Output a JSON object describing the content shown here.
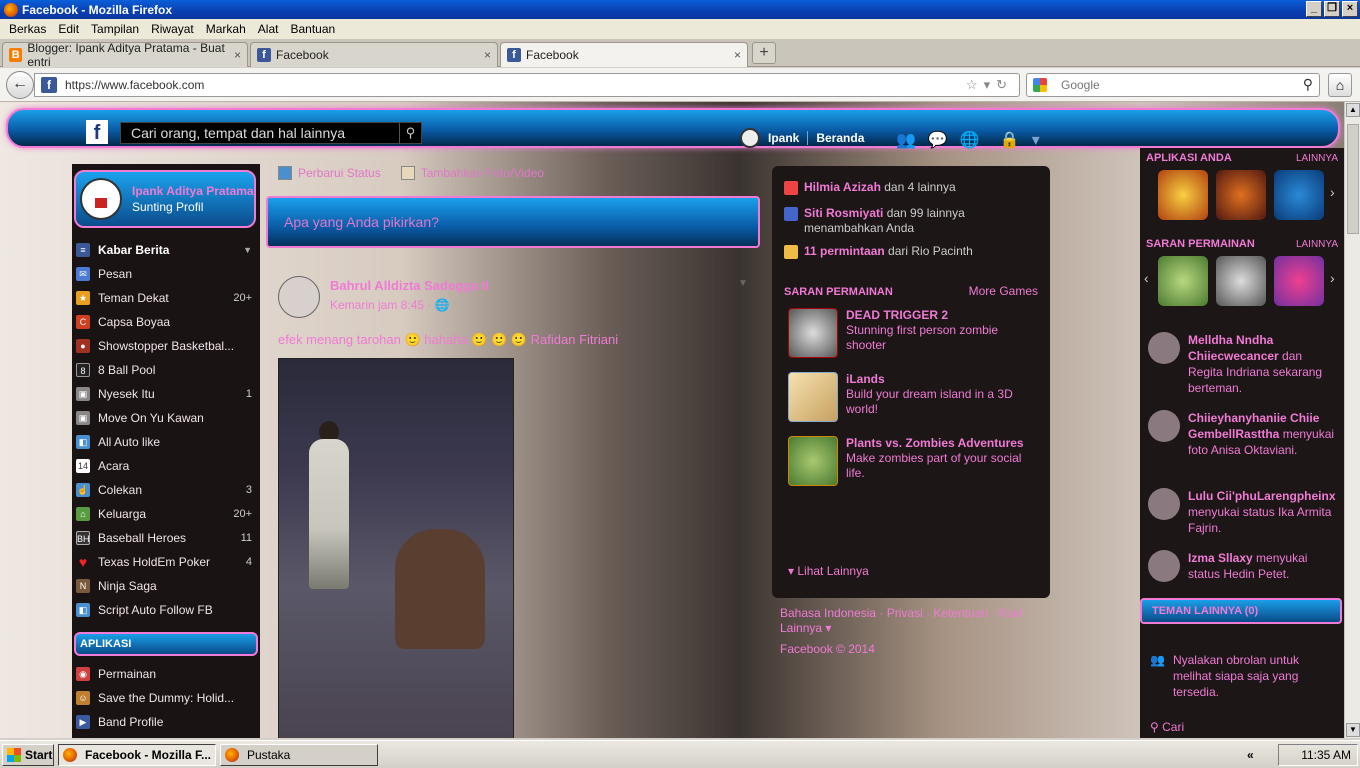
{
  "window": {
    "title": "Facebook - Mozilla Firefox"
  },
  "menu": [
    "Berkas",
    "Edit",
    "Tampilan",
    "Riwayat",
    "Markah",
    "Alat",
    "Bantuan"
  ],
  "tabs": [
    {
      "label": "Blogger: Ipank Aditya Pratama - Buat entri"
    },
    {
      "label": "Facebook"
    },
    {
      "label": "Facebook"
    }
  ],
  "nav": {
    "url": "https://www.facebook.com",
    "search_placeholder": "Google"
  },
  "fb": {
    "search_placeholder": "Cari orang, tempat dan hal lainnya",
    "user_short": "Ipank",
    "home_label": "Beranda",
    "profile_name": "Ipank Aditya Pratama",
    "profile_sub": "Sunting Profil",
    "left_items": [
      {
        "label": "Kabar Berita",
        "count": "",
        "head": true
      },
      {
        "label": "Pesan",
        "count": ""
      },
      {
        "label": "Teman Dekat",
        "count": "20+"
      },
      {
        "label": "Capsa Boyaa",
        "count": ""
      },
      {
        "label": "Showstopper Basketbal...",
        "count": ""
      },
      {
        "label": "8 Ball Pool",
        "count": ""
      },
      {
        "label": "Nyesek Itu",
        "count": "1"
      },
      {
        "label": "Move On Yu Kawan",
        "count": ""
      },
      {
        "label": "All Auto like",
        "count": ""
      },
      {
        "label": "Acara",
        "count": ""
      },
      {
        "label": "Colekan",
        "count": "3"
      },
      {
        "label": "Keluarga",
        "count": "20+"
      },
      {
        "label": "Baseball Heroes",
        "count": "11"
      },
      {
        "label": "Texas HoldEm Poker",
        "count": "4"
      },
      {
        "label": "Ninja Saga",
        "count": ""
      },
      {
        "label": "Script Auto Follow FB",
        "count": ""
      }
    ],
    "apps_header": "APLIKASI",
    "app_items": [
      {
        "label": "Permainan"
      },
      {
        "label": "Save the Dummy: Holid..."
      },
      {
        "label": "Band Profile"
      }
    ],
    "composer": {
      "tab_status": "Perbarui Status",
      "tab_photo": "Tambahkan Foto/Video",
      "placeholder": "Apa yang Anda pikirkan?"
    },
    "post": {
      "author": "Bahrul Alldizta Sadegga II",
      "time": "Kemarin jam 8:45 · 🌐",
      "text": "efek menang tarohan 🙂 hahaha 🙂 🙂 🙂 Rafidan Fitriani"
    },
    "notifications": [
      {
        "bold": "Hilmia Azizah",
        "rest": " dan 4 lainnya",
        "color": "#e44"
      },
      {
        "bold": "Siti Rosmiyati",
        "rest": " dan 99 lainnya menambahkan Anda",
        "color": "#46c"
      },
      {
        "bold": "11 permintaan",
        "rest": " dari Rio Pacinth",
        "color": "#eb4"
      }
    ],
    "suggest_header": "SARAN PERMAINAN",
    "suggest_more": "More Games",
    "games": [
      {
        "title": "DEAD TRIGGER 2",
        "desc": "Stunning first person zombie shooter"
      },
      {
        "title": "iLands",
        "desc": "Build your dream island in a 3D world!"
      },
      {
        "title": "Plants vs. Zombies Adventures",
        "desc": "Make zombies part of your social life."
      }
    ],
    "see_more": "Lihat Lainnya",
    "footer": "Bahasa Indonesia · Privasi · Ketentuan · Kuki · Lainnya ▾",
    "copyright": "Facebook © 2014",
    "right": {
      "apps_h": "APLIKASI ANDA",
      "games_h": "SARAN PERMAINAN",
      "more": "LAINNYA",
      "ticker": [
        {
          "bold": "Melldha Nndha Chiiecwecancer",
          "rest": " dan Regita Indriana sekarang berteman."
        },
        {
          "bold": "Chiieyhanyhaniie Chiie GembellRasttha",
          "rest": " menyukai foto Anisa Oktaviani."
        },
        {
          "bold": "Lulu Cii'phuLarengpheinx",
          "rest": " menyukai status Ika Armita Fajrin."
        },
        {
          "bold": "Izma Sllaxy",
          "rest": " menyukai status Hedin Petet."
        }
      ],
      "friends_more": "TEMAN LAINNYA (0)",
      "chat_note": "Nyalakan obrolan untuk melihat siapa saja yang tersedia.",
      "chat_search": "Cari"
    }
  },
  "taskbar": {
    "start": "Start",
    "task1": "Facebook - Mozilla F...",
    "task2": "Pustaka",
    "clock": "11:35 AM"
  },
  "colors": {
    "accent_pink": "#f07ad4",
    "fb_blue": "#0a5ca8",
    "dark_panel": "#1c1617"
  }
}
